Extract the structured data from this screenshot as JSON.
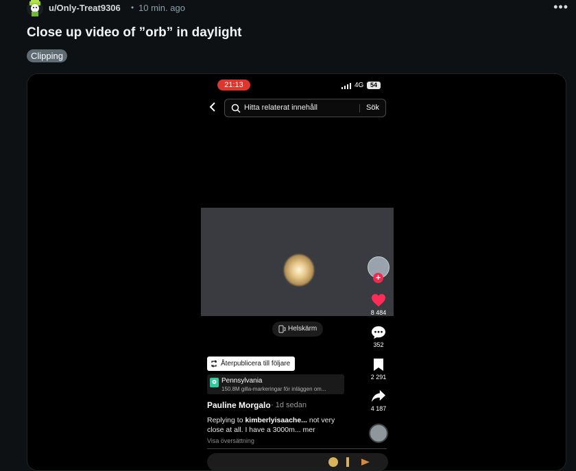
{
  "post": {
    "username": "u/Only-Treat9306",
    "separator": "•",
    "time": "10 min. ago",
    "more_label": "•••",
    "title": "Close up video of ”orb” in daylight",
    "flair": "Clipping"
  },
  "phone": {
    "status_time": "21:13",
    "network": "4G",
    "battery": "54",
    "search_placeholder": "Hitta relaterat innehåll",
    "search_button": "Sök",
    "fullscreen_label": "Helskärm",
    "likes": "8 484",
    "comments": "352",
    "saves": "2 291",
    "shares": "4 187",
    "repost_label": "Återpublicera till följare",
    "location_name": "Pennsylvania",
    "location_sub": "150.8M gilla-markeringar för inläggen om...",
    "author": "Pauline Morgalo",
    "author_time": "· 1d sedan",
    "caption_prefix": "Replying to ",
    "caption_mention": "kimberlyisaache...",
    "caption_rest": "  not very close at all.  I have a 3000m... mer",
    "translate_label": "Visa översättning",
    "follow_plus": "+"
  },
  "colors": {
    "background": "#0e1113",
    "flair_bg": "#5f6b73",
    "status_pill": "#e0352c",
    "like_heart": "#fe2c55",
    "location_icon": "#2ecc9a"
  },
  "icons": [
    "reddit-avatar-icon",
    "more-icon",
    "back-chevron-icon",
    "search-icon",
    "fullscreen-icon",
    "heart-icon",
    "comment-icon",
    "bookmark-icon",
    "share-icon",
    "repost-icon",
    "location-pin-icon"
  ]
}
